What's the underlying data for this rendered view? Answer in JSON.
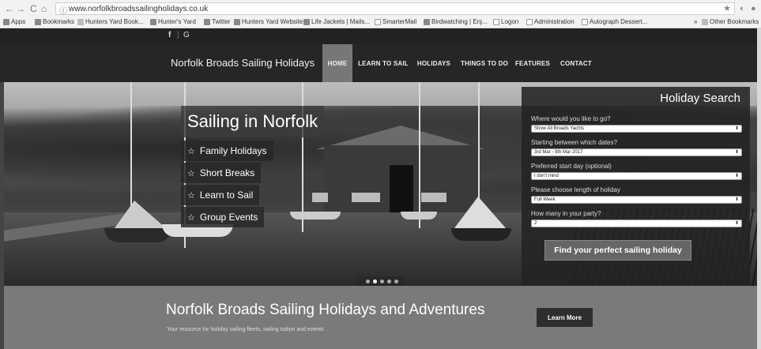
{
  "browser": {
    "back": "←",
    "forward": "→",
    "reload": "C",
    "home": "⌂",
    "info_icon": "ⓘ",
    "url": "www.norfolkbroadssailingholidays.co.uk",
    "star": "★",
    "bookmarks": [
      {
        "label": "Apps",
        "icon": "apps-icon"
      },
      {
        "label": "Bookmarks",
        "icon": "star-icon"
      },
      {
        "label": "Hunters Yard Book...",
        "icon": "folder-icon"
      },
      {
        "label": "Hunter's Yard",
        "icon": "facebook-icon"
      },
      {
        "label": "Twitter",
        "icon": "twitter-icon"
      },
      {
        "label": "Hunters Yard Website",
        "icon": "flag-icon"
      },
      {
        "label": "Life Jackets | Mails...",
        "icon": "site-icon"
      },
      {
        "label": "SmarterMail",
        "icon": "page-icon"
      },
      {
        "label": "Birdwatching | Enj...",
        "icon": "site-icon"
      },
      {
        "label": "Logon",
        "icon": "page-icon"
      },
      {
        "label": "Administration",
        "icon": "page-icon"
      },
      {
        "label": "Autograph Dessert...",
        "icon": "page-icon"
      }
    ],
    "overflow": "»",
    "other_bookmarks": "Other Bookmarks"
  },
  "site": {
    "social": [
      "f",
      "|",
      "G"
    ],
    "brand": "Norfolk Broads Sailing Holidays",
    "menu": [
      "HOME",
      "LEARN TO SAIL",
      "HOLIDAYS",
      "THINGS TO DO",
      "FEATURES",
      "CONTACT"
    ],
    "hero": {
      "tagline": "Sailing in Norfolk",
      "links": [
        "Family Holidays",
        "Short Breaks",
        "Learn to Sail",
        "Group Events"
      ],
      "link_icon": "☆",
      "slides": 5,
      "active_slide": 2
    },
    "search": {
      "title": "Holiday Search",
      "fields": [
        {
          "label": "Where would you like to go?",
          "value": "Show All Broads Yachts"
        },
        {
          "label": "Starting between which dates?",
          "value": "3rd Mar - 9th Mar 2017"
        },
        {
          "label": "Preferred start day (optional)",
          "value": "I don't mind"
        },
        {
          "label": "Please choose length of holiday",
          "value": "Full Week"
        },
        {
          "label": "How many in your party?",
          "value": "2"
        }
      ],
      "select_arrow": "⬍",
      "button": "Find your perfect sailing holiday"
    },
    "band": {
      "heading": "Norfolk Broads Sailing Holidays and Adventures",
      "subtext": "Your resource for holiday sailing fleets, sailing tuition and events",
      "cta": "Learn More"
    }
  },
  "colors": {
    "header_bg": "#262626",
    "active_menu": "#777777",
    "band_bg": "#7a7a7a"
  }
}
